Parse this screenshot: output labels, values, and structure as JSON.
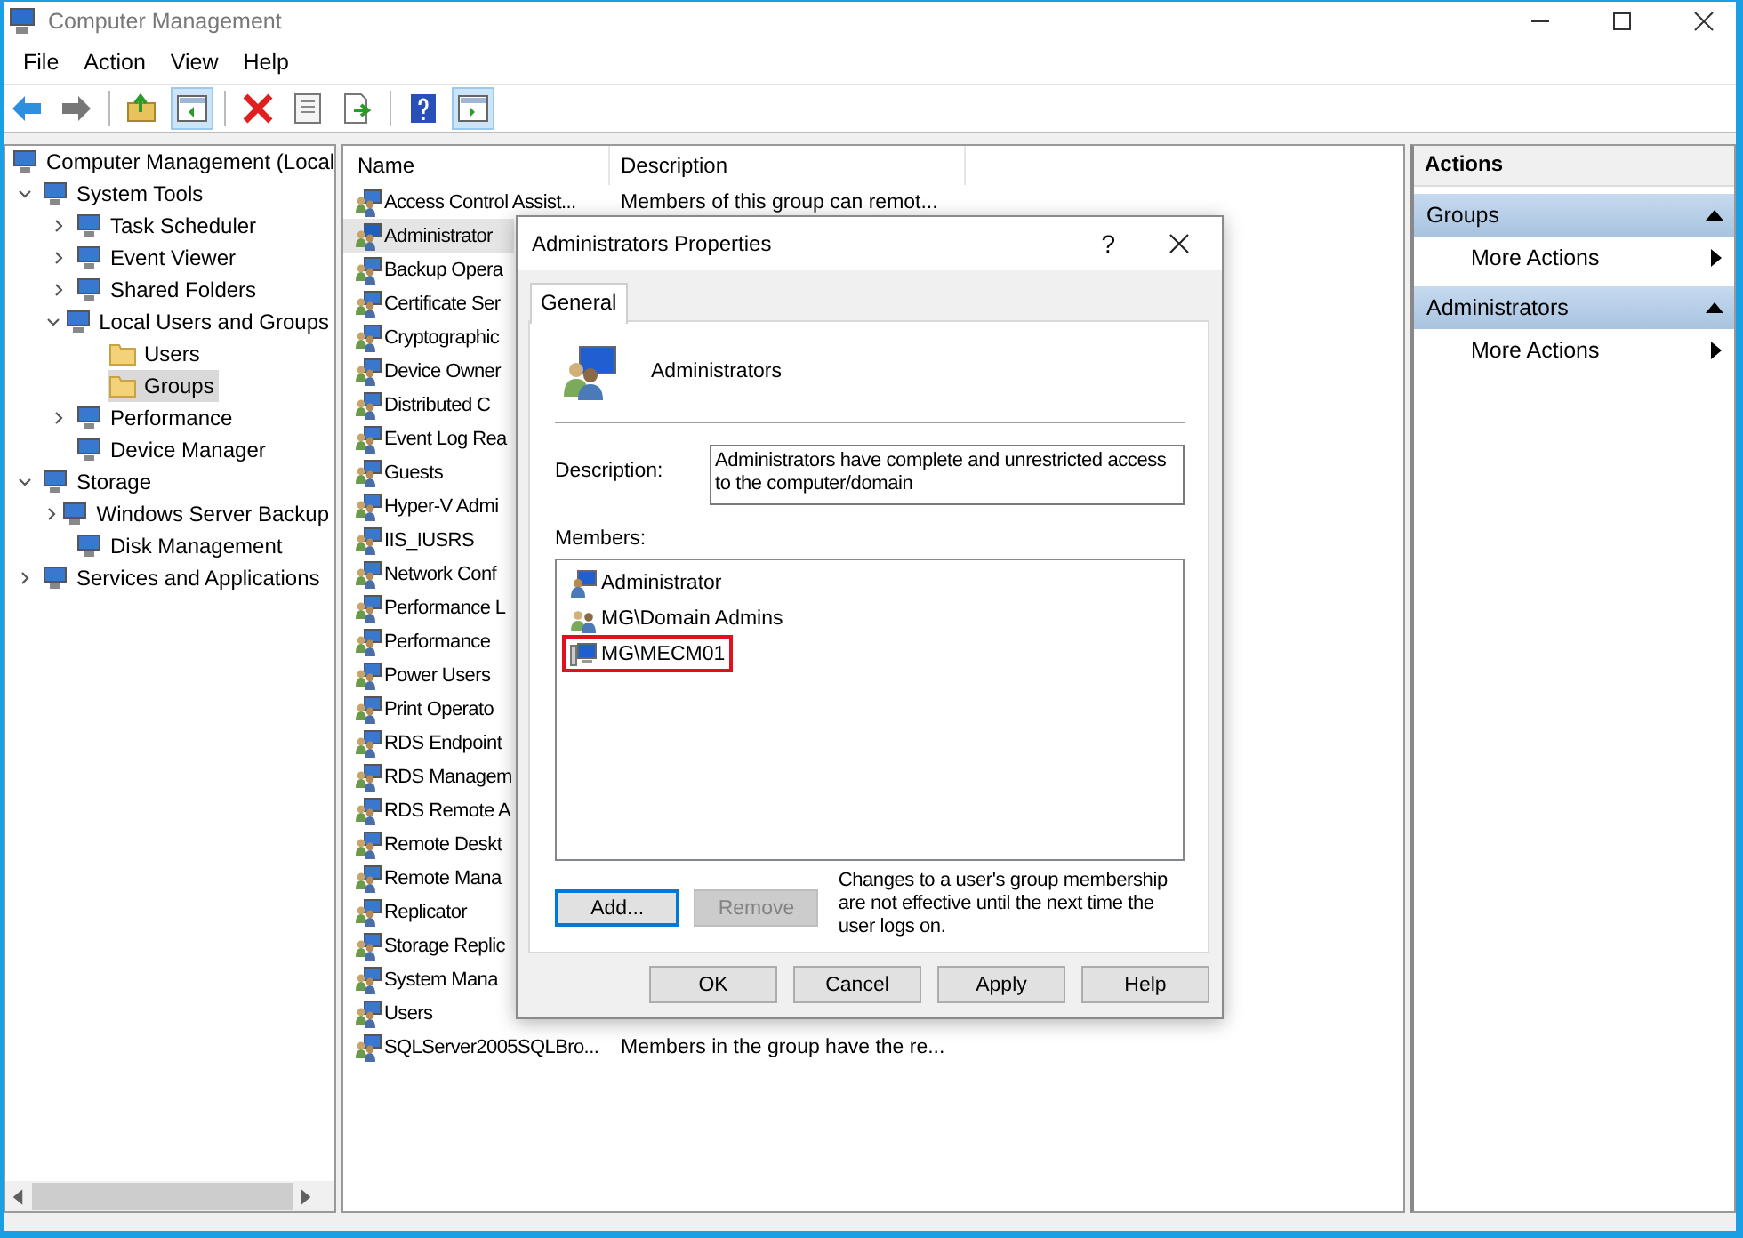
{
  "window": {
    "title": "Computer Management"
  },
  "menu": [
    "File",
    "Action",
    "View",
    "Help"
  ],
  "toolbar": [
    [
      {
        "kind": "back",
        "pressed": false
      },
      {
        "kind": "forward",
        "pressed": false
      }
    ],
    [
      {
        "kind": "up",
        "pressed": false
      },
      {
        "kind": "tree-pane",
        "pressed": true
      }
    ],
    [
      {
        "kind": "delete",
        "pressed": false
      },
      {
        "kind": "properties",
        "pressed": false
      },
      {
        "kind": "export",
        "pressed": false
      }
    ],
    [
      {
        "kind": "help",
        "pressed": false
      },
      {
        "kind": "action-pane",
        "pressed": true
      }
    ]
  ],
  "tree": [
    {
      "label": "Computer Management (Local",
      "selected": false,
      "children": [
        {
          "label": "System Tools",
          "expanded": true,
          "selected": false,
          "children": [
            {
              "label": "Task Scheduler",
              "expanded": false,
              "selected": false
            },
            {
              "label": "Event Viewer",
              "expanded": false,
              "selected": false
            },
            {
              "label": "Shared Folders",
              "expanded": false,
              "selected": false
            },
            {
              "label": "Local Users and Groups",
              "expanded": true,
              "selected": false,
              "children": [
                {
                  "label": "Users",
                  "selected": false
                },
                {
                  "label": "Groups",
                  "selected": true
                }
              ]
            },
            {
              "label": "Performance",
              "expanded": false,
              "selected": false
            },
            {
              "label": "Device Manager",
              "selected": false
            }
          ]
        },
        {
          "label": "Storage",
          "expanded": true,
          "selected": false,
          "children": [
            {
              "label": "Windows Server Backup",
              "expanded": false,
              "selected": false
            },
            {
              "label": "Disk Management",
              "selected": false
            }
          ]
        },
        {
          "label": "Services and Applications",
          "expanded": false,
          "selected": false
        }
      ]
    }
  ],
  "list": {
    "columns": [
      "Name",
      "Description"
    ],
    "rows": [
      {
        "name": "Access Control Assist...",
        "description": "Members of this group can remot...",
        "selected": false
      },
      {
        "name": "Administrator",
        "selected": true
      },
      {
        "name": "Backup Opera",
        "selected": false
      },
      {
        "name": "Certificate Ser",
        "selected": false
      },
      {
        "name": "Cryptographic",
        "selected": false
      },
      {
        "name": "Device Owner",
        "selected": false
      },
      {
        "name": "Distributed C",
        "selected": false
      },
      {
        "name": "Event Log Rea",
        "selected": false
      },
      {
        "name": "Guests",
        "selected": false
      },
      {
        "name": "Hyper-V Admi",
        "selected": false
      },
      {
        "name": "IIS_IUSRS",
        "selected": false
      },
      {
        "name": "Network Conf",
        "selected": false
      },
      {
        "name": "Performance L",
        "selected": false
      },
      {
        "name": "Performance",
        "selected": false
      },
      {
        "name": "Power Users",
        "selected": false
      },
      {
        "name": "Print Operato",
        "selected": false
      },
      {
        "name": "RDS Endpoint",
        "selected": false
      },
      {
        "name": "RDS Managem",
        "selected": false
      },
      {
        "name": "RDS Remote A",
        "selected": false
      },
      {
        "name": "Remote Deskt",
        "selected": false
      },
      {
        "name": "Remote Mana",
        "selected": false
      },
      {
        "name": "Replicator",
        "selected": false
      },
      {
        "name": "Storage Replic",
        "selected": false
      },
      {
        "name": "System Mana",
        "selected": false
      },
      {
        "name": "Users",
        "selected": false
      },
      {
        "name": "SQLServer2005SQLBro...",
        "description": "Members in the group have the re...",
        "selected": false
      }
    ]
  },
  "actions": {
    "title": "Actions",
    "sections": [
      {
        "title": "Groups",
        "items": [
          "More Actions"
        ]
      },
      {
        "title": "Administrators",
        "items": [
          "More Actions"
        ]
      }
    ]
  },
  "dialog": {
    "title": "Administrators Properties",
    "help": "?",
    "tabs": [
      {
        "label": "General",
        "selected": true
      }
    ],
    "name": "Administrators",
    "description_label": "Description:",
    "description": "Administrators have complete and unrestricted access to the computer/domain",
    "members_label": "Members:",
    "members": [
      {
        "name": "Administrator",
        "kind": "user",
        "highlighted": false
      },
      {
        "name": "MG\\Domain Admins",
        "kind": "group",
        "highlighted": false
      },
      {
        "name": "MG\\MECM01",
        "kind": "computer",
        "highlighted": true
      }
    ],
    "member_buttons": [
      {
        "label": "Add...",
        "focused": true,
        "disabled": false
      },
      {
        "label": "Remove",
        "focused": false,
        "disabled": true
      }
    ],
    "note": "Changes to a user's group membership are not effective until the next time the user logs on.",
    "buttons": [
      "OK",
      "Cancel",
      "Apply",
      "Help"
    ]
  }
}
